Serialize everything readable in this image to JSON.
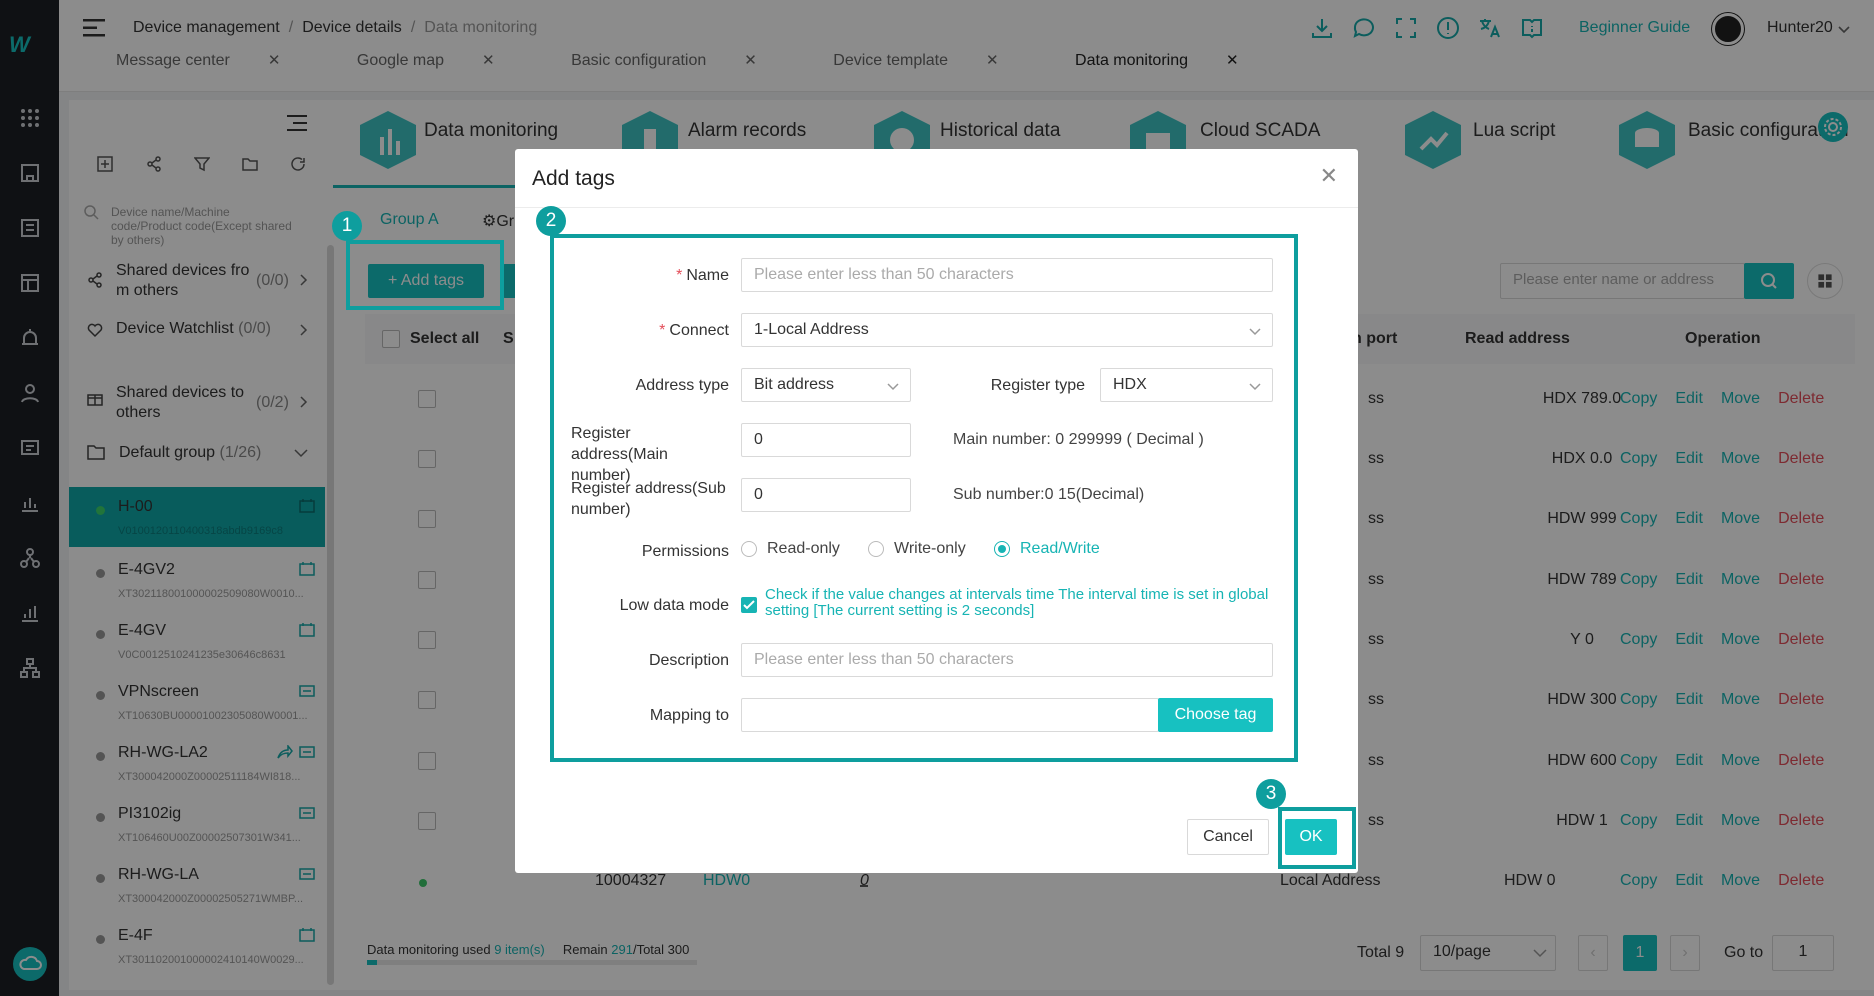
{
  "app": {
    "logo_text": "W"
  },
  "breadcrumb": {
    "items": [
      "Device management",
      "Device details"
    ],
    "current": "Data monitoring"
  },
  "tabs": [
    "Message center",
    "Google map",
    "Basic configuration",
    "Device template",
    "Data monitoring"
  ],
  "header": {
    "guide": "Beginner Guide",
    "user": "Hunter20"
  },
  "sidebar": {
    "search_placeholder": "Device name/Machine code/Product code(Except shared by others)",
    "shared_from": "Shared devices fro m others",
    "shared_from_count": "(0/0)",
    "watchlist": "Device Watchlist",
    "watchlist_count": "(0/0)",
    "shared_to": "Shared devices to others",
    "shared_to_count": "(0/2)",
    "group": "Default group",
    "group_count": "(1/26)",
    "devices": [
      {
        "name": "H-00",
        "serial": "V0100120110400318abdb9169c8"
      },
      {
        "name": "E-4GV2",
        "serial": "XT302118001000002509080W0010..."
      },
      {
        "name": "E-4GV",
        "serial": "V0C0012510241235e30646c8631"
      },
      {
        "name": "VPNscreen",
        "serial": "XT10630BU00001002305080W0001..."
      },
      {
        "name": "RH-WG-LA2",
        "serial": "XT300042000Z00002511184WI818..."
      },
      {
        "name": "PI3102ig",
        "serial": "XT106460U00Z00002507301W341..."
      },
      {
        "name": "RH-WG-LA",
        "serial": "XT300042000Z00002505271WMBP..."
      },
      {
        "name": "E-4F",
        "serial": "XT301102001000002410140W0029..."
      }
    ]
  },
  "main_tabs": [
    "Data monitoring",
    "Alarm records",
    "Historical data",
    "Cloud SCADA",
    "Lua script",
    "Basic configuration"
  ],
  "group_tab": "Group A",
  "group_tab2": "Gr",
  "add_tags_button": "Add tags",
  "search_placeholder": "Please enter name or address",
  "table": {
    "headers": {
      "select": "Select all",
      "status": "S",
      "port": "n port",
      "read": "Read address",
      "operation": "Operation"
    },
    "rows": [
      {
        "port": "ss",
        "read": "HDX 789.0"
      },
      {
        "port": "ss",
        "read": "HDX 0.0"
      },
      {
        "port": "ss",
        "read": "HDW 999"
      },
      {
        "port": "ss",
        "read": "HDW 789"
      },
      {
        "port": "ss",
        "read": "Y 0"
      },
      {
        "port": "ss",
        "read": "HDW 300"
      },
      {
        "port": "ss",
        "read": "HDW 600"
      },
      {
        "port": "ss",
        "read": "HDW 1"
      }
    ],
    "last_row": {
      "id": "10004327",
      "addr": "HDW0",
      "val": "0",
      "port": "Local Address",
      "read": "HDW 0"
    },
    "ops": [
      "Copy",
      "Edit",
      "Move",
      "Delete"
    ]
  },
  "footer": {
    "used_label": "Data monitoring used",
    "used_value": "9 item(s)",
    "remain_label": "Remain",
    "remain_value": "291",
    "total_label": "/Total 300",
    "total": "Total 9",
    "page_size": "10/page",
    "page": "1",
    "goto": "Go to",
    "goto_value": "1"
  },
  "modal": {
    "title": "Add tags",
    "name_label": "Name",
    "name_placeholder": "Please enter less than 50 characters",
    "connect_label": "Connect",
    "connect_value": "1-Local Address",
    "addr_type_label": "Address type",
    "addr_type_value": "Bit address",
    "reg_type_label": "Register type",
    "reg_type_value": "HDX",
    "reg_main_label": "Register address(Main number)",
    "reg_main_value": "0",
    "reg_main_hint": "Main number: 0 299999 ( Decimal )",
    "reg_sub_label": "Register address(Sub number)",
    "reg_sub_value": "0",
    "reg_sub_hint": "Sub number:0 15(Decimal)",
    "perm_label": "Permissions",
    "perm_options": [
      "Read-only",
      "Write-only",
      "Read/Write"
    ],
    "perm_selected": "Read/Write",
    "low_label": "Low data mode",
    "low_text": "Check if the value changes at intervals time The interval time is set in global setting [The current setting is 2 seconds]",
    "desc_label": "Description",
    "desc_placeholder": "Please enter less than 50 characters",
    "map_label": "Mapping to",
    "map_button": "Choose tag",
    "cancel": "Cancel",
    "ok": "OK"
  },
  "badges": [
    "1",
    "2",
    "3"
  ],
  "colors": {
    "accent": "#17c1c1",
    "highlight": "#0e9e9e",
    "danger": "#e34d59"
  }
}
